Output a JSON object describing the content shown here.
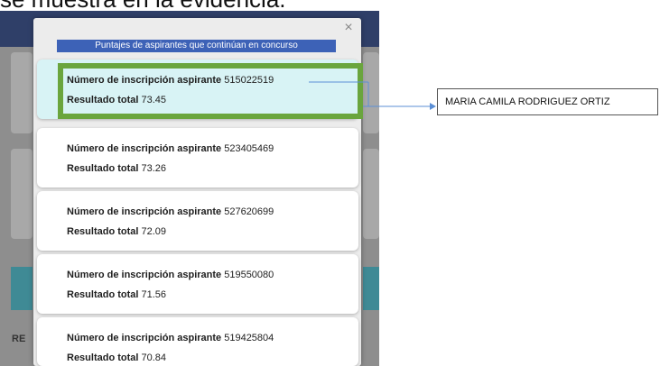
{
  "evidence_caption": "se muestra en la evidencia.",
  "background": {
    "section_label": "RE"
  },
  "modal": {
    "close_glyph": "×",
    "title": "Puntajes de aspirantes que continúan en concurso",
    "entries": [
      {
        "number_label": "Número de inscripción aspirante",
        "number": "515022519",
        "score_label": "Resultado total",
        "score": "73.45",
        "highlighted": true
      },
      {
        "number_label": "Número de inscripción aspirante",
        "number": "523405469",
        "score_label": "Resultado total",
        "score": "73.26",
        "highlighted": false
      },
      {
        "number_label": "Número de inscripción aspirante",
        "number": "527620699",
        "score_label": "Resultado total",
        "score": "72.09",
        "highlighted": false
      },
      {
        "number_label": "Número de inscripción aspirante",
        "number": "519550080",
        "score_label": "Resultado total",
        "score": "71.56",
        "highlighted": false
      },
      {
        "number_label": "Número de inscripción aspirante",
        "number": "519425804",
        "score_label": "Resultado total",
        "score": "70.84",
        "highlighted": false
      }
    ]
  },
  "annotation": {
    "name": "MARIA CAMILA RODRIGUEZ ORTIZ",
    "highlight_color": "#6aa53d",
    "arrow_color": "#5b8fd6"
  },
  "colors": {
    "modal_title_bg": "#3d62b7",
    "header_bg": "#2f3f68",
    "highlight_card_bg": "#d8f3f5"
  }
}
